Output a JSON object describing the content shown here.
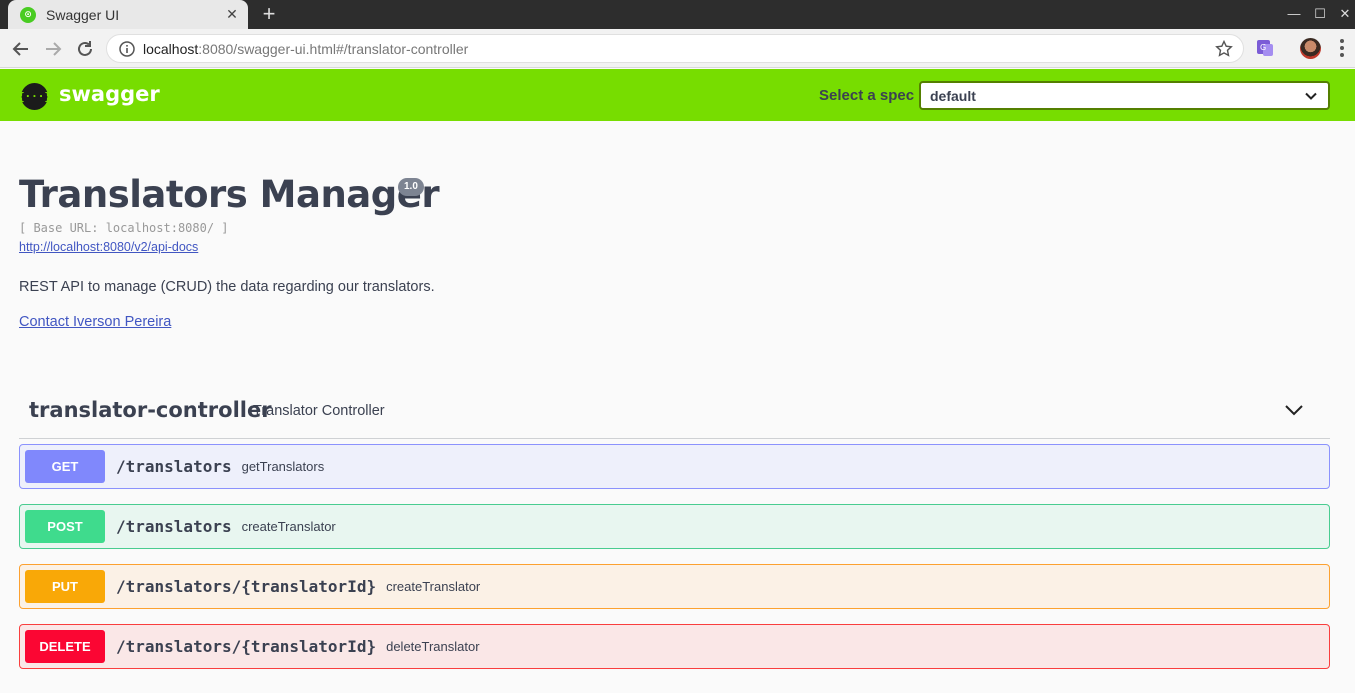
{
  "browser": {
    "tab_title": "Swagger UI",
    "url_host": "localhost",
    "url_rest": ":8080/swagger-ui.html#/translator-controller"
  },
  "topbar": {
    "logo_glyph": "{···}",
    "logo_text": "swagger",
    "spec_label": "Select a spec",
    "spec_value": "default"
  },
  "info": {
    "title": "Translators Manager",
    "version": "1.0",
    "base_url": "[ Base URL: localhost:8080/ ]",
    "api_docs_link": "http://localhost:8080/v2/api-docs",
    "description": "REST API to manage (CRUD) the data regarding our translators.",
    "contact": "Contact Iverson Pereira"
  },
  "tag": {
    "name": "translator-controller",
    "description": "Translator Controller"
  },
  "operations": [
    {
      "method": "GET",
      "path": "/translators",
      "summary": "getTranslators"
    },
    {
      "method": "POST",
      "path": "/translators",
      "summary": "createTranslator"
    },
    {
      "method": "PUT",
      "path": "/translators/{translatorId}",
      "summary": "createTranslator"
    },
    {
      "method": "DELETE",
      "path": "/translators/{translatorId}",
      "summary": "deleteTranslator"
    }
  ],
  "colors": {
    "topbar": "#77dd00",
    "get": "#8088fc",
    "post": "#3fdb8d",
    "put": "#f9a807",
    "delete": "#fb0633"
  }
}
